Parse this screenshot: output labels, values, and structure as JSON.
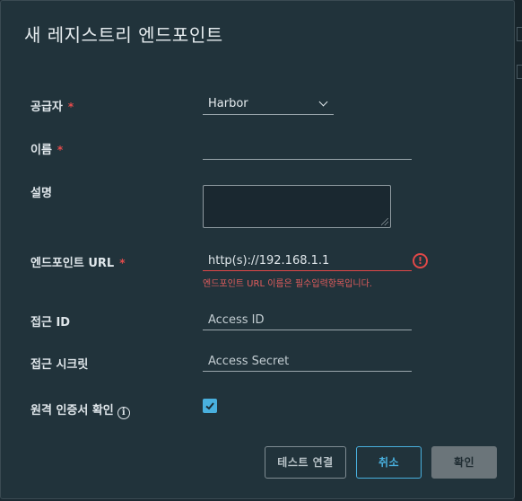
{
  "dialog": {
    "title": "새 레지스트리 엔드포인트"
  },
  "form": {
    "provider": {
      "label": "공급자",
      "required_mark": "*",
      "value": "Harbor"
    },
    "name": {
      "label": "이름",
      "required_mark": "*",
      "value": ""
    },
    "description": {
      "label": "설명",
      "value": ""
    },
    "endpoint_url": {
      "label": "엔드포인트 URL",
      "required_mark": "*",
      "value": "http(s)://192.168.1.1",
      "error_message": "엔드포인트 URL 이름은 필수입력항목입니다."
    },
    "access_id": {
      "label": "접근 ID",
      "placeholder": "Access ID"
    },
    "access_secret": {
      "label": "접근 시크릿",
      "placeholder": "Access Secret"
    },
    "verify_cert": {
      "label": "원격 인증서 확인",
      "checked": true
    }
  },
  "buttons": {
    "test_connection": "테스트 연결",
    "cancel": "취소",
    "ok": "확인"
  },
  "colors": {
    "accent": "#49b0de",
    "error": "#e04848",
    "background": "#21333b"
  }
}
